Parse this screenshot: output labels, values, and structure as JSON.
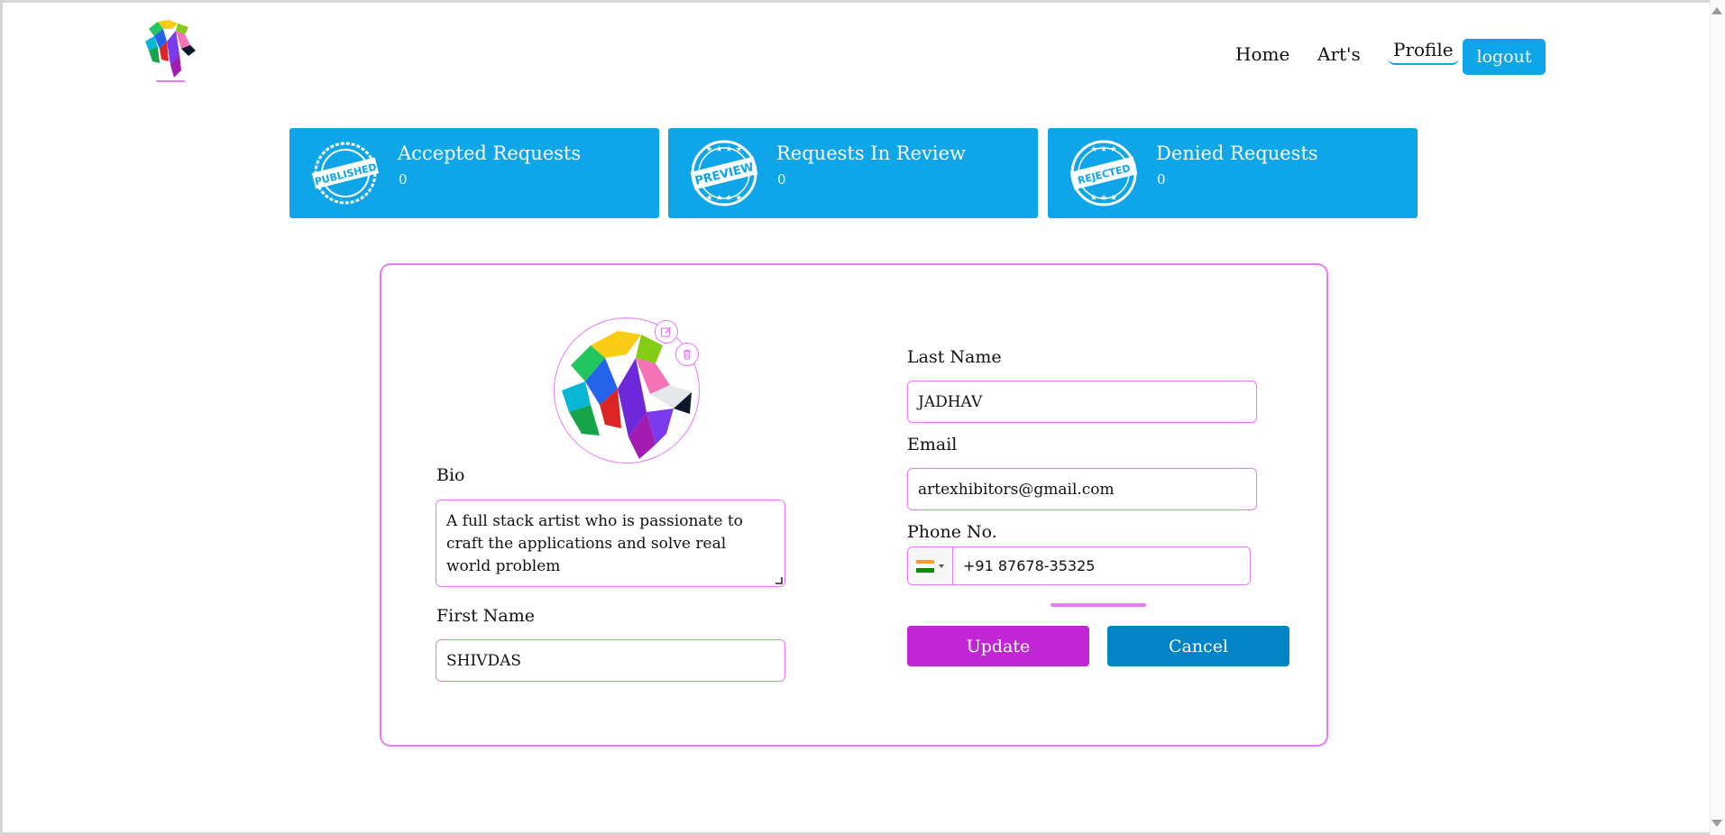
{
  "header": {
    "nav": {
      "home": "Home",
      "arts": "Art's",
      "profile": "Profile"
    },
    "logout_label": "logout"
  },
  "stats": [
    {
      "title": "Accepted Requests",
      "count": "0",
      "icon": "published-stamp-icon"
    },
    {
      "title": "Requests In Review",
      "count": "0",
      "icon": "preview-stamp-icon"
    },
    {
      "title": "Denied Requests",
      "count": "0",
      "icon": "rejected-stamp-icon"
    }
  ],
  "stamps": {
    "published": "PUBLISHED",
    "preview": "PREVIEW",
    "rejected": "REJECTED"
  },
  "profile_form": {
    "avatar_icon": "lion-avatar",
    "edit_icon": "edit-icon",
    "delete_icon": "trash-icon",
    "bio_label": "Bio",
    "bio_value": "A full stack artist who is passionate to craft the applications and solve real world problem",
    "first_name_label": "First Name",
    "first_name_value": "SHIVDAS",
    "last_name_label": "Last Name",
    "last_name_value": "JADHAV",
    "email_label": "Email",
    "email_value": "artexhibitors@gmail.com",
    "phone_label": "Phone No.",
    "phone_value": "+91 87678-35325",
    "phone_country_icon": "india-flag-icon",
    "update_label": "Update",
    "cancel_label": "Cancel"
  },
  "colors": {
    "accent_blue": "#0ea5e9",
    "border_pink": "#e879f9",
    "update_purple": "#c026d3",
    "cancel_blue": "#0284c7"
  }
}
